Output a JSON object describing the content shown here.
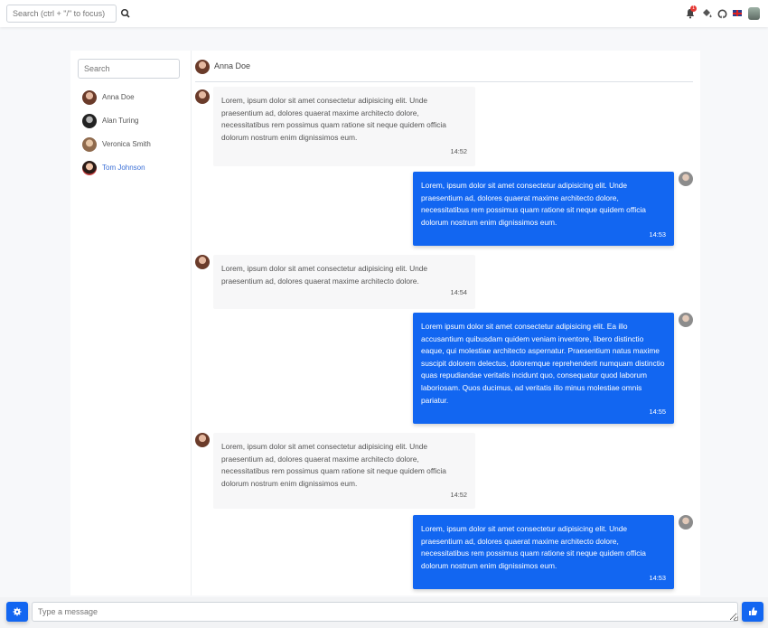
{
  "topbar": {
    "search_placeholder": "Search (ctrl + \"/\" to focus)",
    "notification_count": "1",
    "icons": [
      "search-icon",
      "bell-icon",
      "paint-bucket-icon",
      "github-icon",
      "uk-flag-icon",
      "user-avatar"
    ]
  },
  "sidebar": {
    "search_placeholder": "Search",
    "contacts": [
      {
        "name": "Anna Doe",
        "active": false
      },
      {
        "name": "Alan Turing",
        "active": false
      },
      {
        "name": "Veronica Smith",
        "active": false
      },
      {
        "name": "Tom Johnson",
        "active": true
      }
    ]
  },
  "chat": {
    "header_name": "Anna Doe",
    "messages": [
      {
        "direction": "in",
        "text": "Lorem, ipsum dolor sit amet consectetur adipisicing elit. Unde praesentium ad, dolores quaerat maxime architecto dolore, necessitatibus rem possimus quam ratione sit neque quidem officia dolorum nostrum enim dignissimos eum.",
        "time": "14:52"
      },
      {
        "direction": "out",
        "text": "Lorem, ipsum dolor sit amet consectetur adipisicing elit. Unde praesentium ad, dolores quaerat maxime architecto dolore, necessitatibus rem possimus quam ratione sit neque quidem officia dolorum nostrum enim dignissimos eum.",
        "time": "14:53"
      },
      {
        "direction": "in",
        "text": "Lorem, ipsum dolor sit amet consectetur adipisicing elit. Unde praesentium ad, dolores quaerat maxime architecto dolore.",
        "time": "14:54"
      },
      {
        "direction": "out",
        "text": "Lorem ipsum dolor sit amet consectetur adipisicing elit. Ea illo accusantium quibusdam quidem veniam inventore, libero distinctio eaque, qui molestiae architecto aspernatur. Praesentium natus maxime suscipit dolorem delectus, doloremque reprehenderit numquam distinctio quas repudiandae veritatis incidunt quo, consequatur quod laborum laboriosam. Quos ducimus, ad veritatis illo minus molestiae omnis pariatur.",
        "time": "14:55"
      },
      {
        "direction": "in",
        "text": "Lorem, ipsum dolor sit amet consectetur adipisicing elit. Unde praesentium ad, dolores quaerat maxime architecto dolore, necessitatibus rem possimus quam ratione sit neque quidem officia dolorum nostrum enim dignissimos eum.",
        "time": "14:52"
      },
      {
        "direction": "out",
        "text": "Lorem, ipsum dolor sit amet consectetur adipisicing elit. Unde praesentium ad, dolores quaerat maxime architecto dolore, necessitatibus rem possimus quam ratione sit neque quidem officia dolorum nostrum enim dignissimos eum.",
        "time": "14:53"
      }
    ]
  },
  "composer": {
    "placeholder": "Type a message",
    "left_button_icon": "gear-icon",
    "send_button_icon": "thumbs-up-icon"
  },
  "colors": {
    "accent": "#1266f1",
    "active_contact": "#3b6fd6",
    "incoming_bubble": "#f7f7f8"
  }
}
